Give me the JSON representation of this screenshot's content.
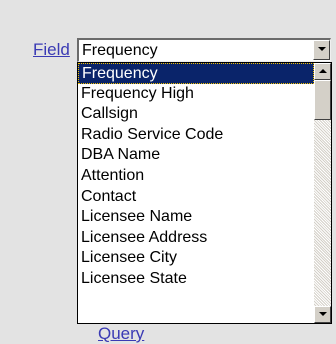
{
  "field_label": "Field",
  "select": {
    "value": "Frequency",
    "options": [
      "Frequency",
      "Frequency High",
      "Callsign",
      "Radio Service Code",
      "DBA Name",
      "Attention",
      "Contact",
      "Licensee Name",
      "Licensee Address",
      "Licensee City",
      "Licensee State"
    ],
    "selected_index": 0
  },
  "query_link": "Query",
  "icons": {
    "dropdown": "chevron-down-icon",
    "scroll_up": "scroll-up-icon",
    "scroll_down": "scroll-down-icon"
  }
}
